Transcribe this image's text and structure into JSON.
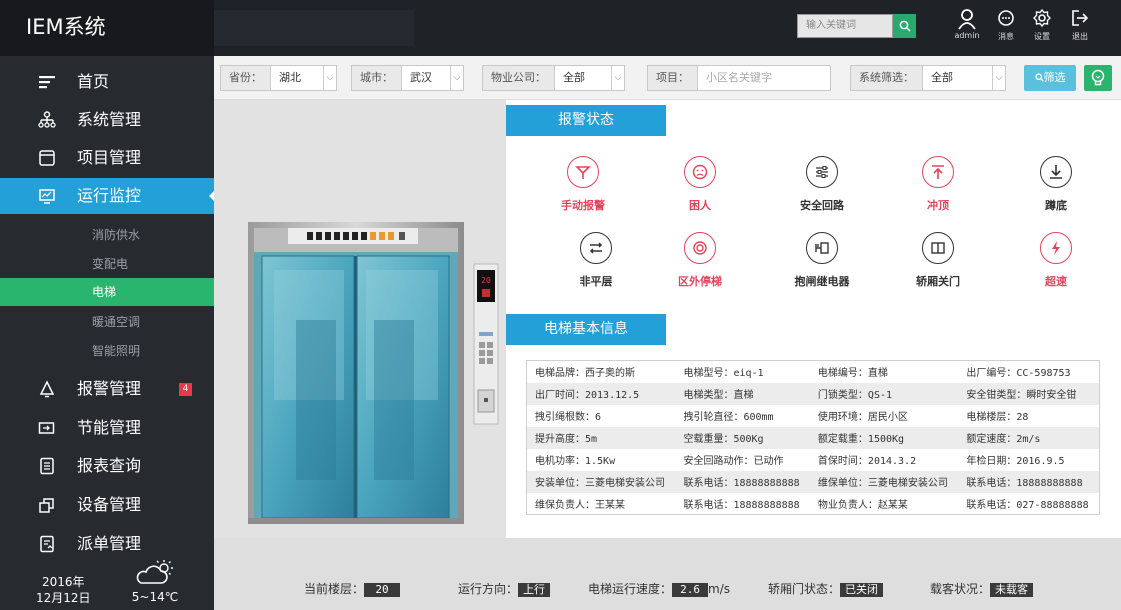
{
  "app": {
    "title": "IEM系统"
  },
  "header": {
    "search_placeholder": "输入关键词",
    "tools": [
      {
        "name": "user-icon",
        "label": "admin"
      },
      {
        "name": "message-icon",
        "label": "消息"
      },
      {
        "name": "gear-icon",
        "label": "设置"
      },
      {
        "name": "logout-icon",
        "label": "退出"
      }
    ]
  },
  "sidebar": {
    "items": [
      {
        "label": "首页",
        "icon": "menu-lines-icon"
      },
      {
        "label": "系统管理",
        "icon": "org-chart-icon"
      },
      {
        "label": "项目管理",
        "icon": "folder-icon"
      },
      {
        "label": "运行监控",
        "icon": "monitor-icon",
        "active": true
      },
      {
        "label": "报警管理",
        "icon": "bell-icon",
        "badge": "4"
      },
      {
        "label": "节能管理",
        "icon": "battery-icon"
      },
      {
        "label": "报表查询",
        "icon": "report-icon"
      },
      {
        "label": "设备管理",
        "icon": "device-icon"
      },
      {
        "label": "派单管理",
        "icon": "dispatch-icon"
      }
    ],
    "subitems": [
      {
        "label": "消防供水"
      },
      {
        "label": "变配电"
      },
      {
        "label": "电梯",
        "active": true
      },
      {
        "label": "暖通空调"
      },
      {
        "label": "智能照明"
      }
    ],
    "date": {
      "year": "2016年",
      "day": "12月12日"
    },
    "weather": {
      "temp": "5~14℃",
      "icon": "partly-cloudy-icon"
    }
  },
  "filters": {
    "province": {
      "label": "省份：",
      "value": "湖北"
    },
    "city": {
      "label": "城市：",
      "value": "武汉"
    },
    "company": {
      "label": "物业公司：",
      "value": "全部"
    },
    "project": {
      "label": "项目：",
      "placeholder": "小区名关键字"
    },
    "system": {
      "label": "系统筛选：",
      "value": "全部"
    },
    "filter_button": "筛选"
  },
  "elevator_display": {
    "floor": "20"
  },
  "alarm": {
    "title": "报警状态",
    "items": [
      {
        "label": "手动报警",
        "state": "alert",
        "icon": "manual-alarm-icon"
      },
      {
        "label": "困人",
        "state": "alert",
        "icon": "trapped-face-icon"
      },
      {
        "label": "安全回路",
        "state": "normal",
        "icon": "sliders-icon"
      },
      {
        "label": "冲顶",
        "state": "alert",
        "icon": "top-overrun-icon"
      },
      {
        "label": "蹲底",
        "state": "normal",
        "icon": "bottom-overrun-icon"
      },
      {
        "label": "非平层",
        "state": "normal",
        "icon": "uneven-floor-icon"
      },
      {
        "label": "区外停梯",
        "state": "alert",
        "icon": "zone-stop-icon"
      },
      {
        "label": "抱闸继电器",
        "state": "normal",
        "icon": "relay-icon"
      },
      {
        "label": "轿厢关门",
        "state": "normal",
        "icon": "door-icon"
      },
      {
        "label": "超速",
        "state": "alert",
        "icon": "lightning-icon"
      }
    ]
  },
  "info": {
    "title": "电梯基本信息",
    "rows": [
      [
        "电梯品牌：西子奥的斯",
        "电梯型号：eiq-1",
        "电梯编号：直梯",
        "出厂编号：CC-598753"
      ],
      [
        "出厂时间：2013.12.5",
        "电梯类型：直梯",
        "门锁类型：QS-1",
        "安全钳类型：瞬时安全钳"
      ],
      [
        "拽引绳根数：6",
        "拽引轮直径：600mm",
        "使用环境：居民小区",
        "电梯楼层：28"
      ],
      [
        "提升高度：5m",
        "空载重量：500Kg",
        "额定载重：1500Kg",
        "额定速度：2m/s"
      ],
      [
        "电机功率：1.5Kw",
        "安全回路动作：已动作",
        "首保时间：2014.3.2",
        "年检日期：2016.9.5"
      ],
      [
        "安装单位：三菱电梯安装公司",
        "联系电话：18888888888",
        "维保单位：三菱电梯安装公司",
        "联系电话：18888888888"
      ],
      [
        "维保负责人：王某某",
        "联系电话：18888888888",
        "物业负责人：赵某某",
        "联系电话：027-88888888"
      ]
    ]
  },
  "status": {
    "floor": {
      "label": "当前楼层：",
      "value": "20"
    },
    "direction": {
      "label": "运行方向：",
      "value": "上行"
    },
    "speed": {
      "label": "电梯运行速度：",
      "value": "2.6",
      "unit": "m/s"
    },
    "door": {
      "label": "轿厢门状态：",
      "value": "已关闭"
    },
    "load": {
      "label": "载客状况：",
      "value": "未载客"
    }
  },
  "colors": {
    "accent": "#23a0d7",
    "success": "#2ab56e",
    "alert": "#e2445c",
    "sidebar": "#272a2f"
  }
}
